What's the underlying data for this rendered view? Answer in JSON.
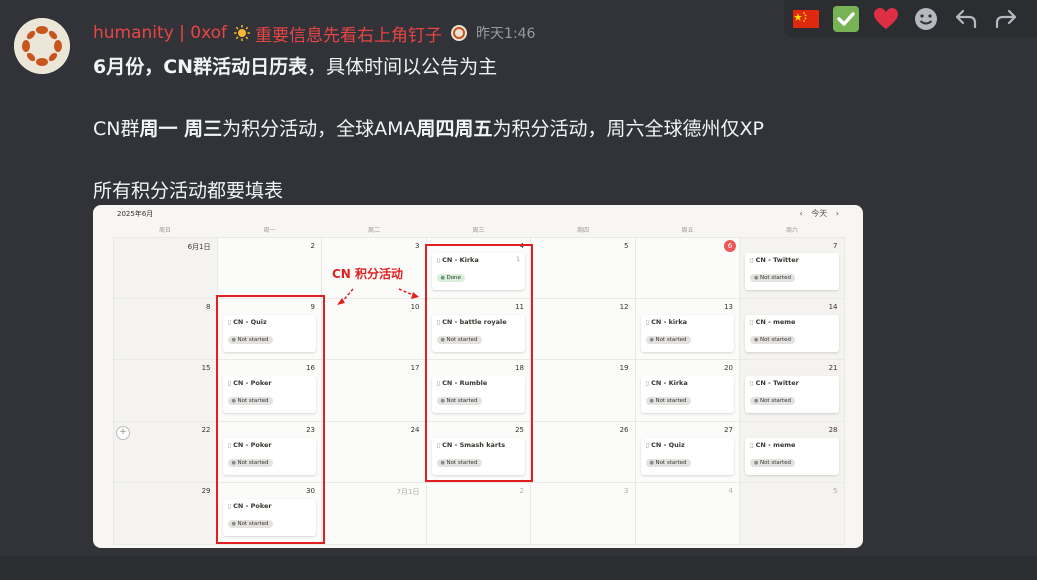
{
  "message": {
    "username": "humanity | 0xof",
    "tagline": "重要信息先看右上角钉子",
    "timestamp": "昨天1:46",
    "line1": {
      "bold": "6月份，CN群活动日历表",
      "normal": "，具体时间以公告为主"
    },
    "line2": {
      "p1": "CN群",
      "b1": "周一 周三",
      "p2": "为积分活动，全球AMA",
      "b2": "周四周五",
      "p3": "为积分活动，周六全球德州仅XP"
    },
    "line3": "所有积分活动都要填表"
  },
  "toolbar": {
    "icons": [
      "china-flag-icon",
      "check-mark-icon",
      "heart-icon",
      "add-reaction-icon",
      "reply-icon",
      "forward-icon"
    ]
  },
  "calendar": {
    "title": "2025年6月",
    "today_label": "今天",
    "weekdays": [
      "周日",
      "周一",
      "周二",
      "周三",
      "周四",
      "周五",
      "周六"
    ],
    "annotation": "CN 积分活动",
    "weeks": [
      [
        "6月1日",
        "2",
        "3",
        "4",
        "5",
        "6",
        "7"
      ],
      [
        "8",
        "9",
        "10",
        "11",
        "12",
        "13",
        "14"
      ],
      [
        "15",
        "16",
        "17",
        "18",
        "19",
        "20",
        "21"
      ],
      [
        "22",
        "23",
        "24",
        "25",
        "26",
        "27",
        "28"
      ],
      [
        "29",
        "30",
        "7月1日",
        "2",
        "3",
        "4",
        "5"
      ]
    ],
    "events": [
      {
        "week": 0,
        "day": 3,
        "title": "CN - Kirka",
        "status": "Done",
        "comments": "1"
      },
      {
        "week": 0,
        "day": 6,
        "title": "CN - Twitter",
        "status": "Not started"
      },
      {
        "week": 1,
        "day": 1,
        "title": "CN - Quiz",
        "status": "Not started"
      },
      {
        "week": 1,
        "day": 3,
        "title": "CN - battle royale",
        "status": "Not started"
      },
      {
        "week": 1,
        "day": 5,
        "title": "CN - kirka",
        "status": "Not started"
      },
      {
        "week": 1,
        "day": 6,
        "title": "CN - meme",
        "status": "Not started"
      },
      {
        "week": 2,
        "day": 1,
        "title": "CN - Poker",
        "status": "Not started"
      },
      {
        "week": 2,
        "day": 3,
        "title": "CN - Rumble",
        "status": "Not started"
      },
      {
        "week": 2,
        "day": 5,
        "title": "CN - Kirka",
        "status": "Not started"
      },
      {
        "week": 2,
        "day": 6,
        "title": "CN - Twitter",
        "status": "Not started"
      },
      {
        "week": 3,
        "day": 1,
        "title": "CN - Poker",
        "status": "Not started"
      },
      {
        "week": 3,
        "day": 3,
        "title": "CN - Smash karts",
        "status": "Not started"
      },
      {
        "week": 3,
        "day": 5,
        "title": "CN - Quiz",
        "status": "Not started"
      },
      {
        "week": 3,
        "day": 6,
        "title": "CN - meme",
        "status": "Not started"
      },
      {
        "week": 4,
        "day": 1,
        "title": "CN - Poker",
        "status": "Not started"
      }
    ]
  }
}
